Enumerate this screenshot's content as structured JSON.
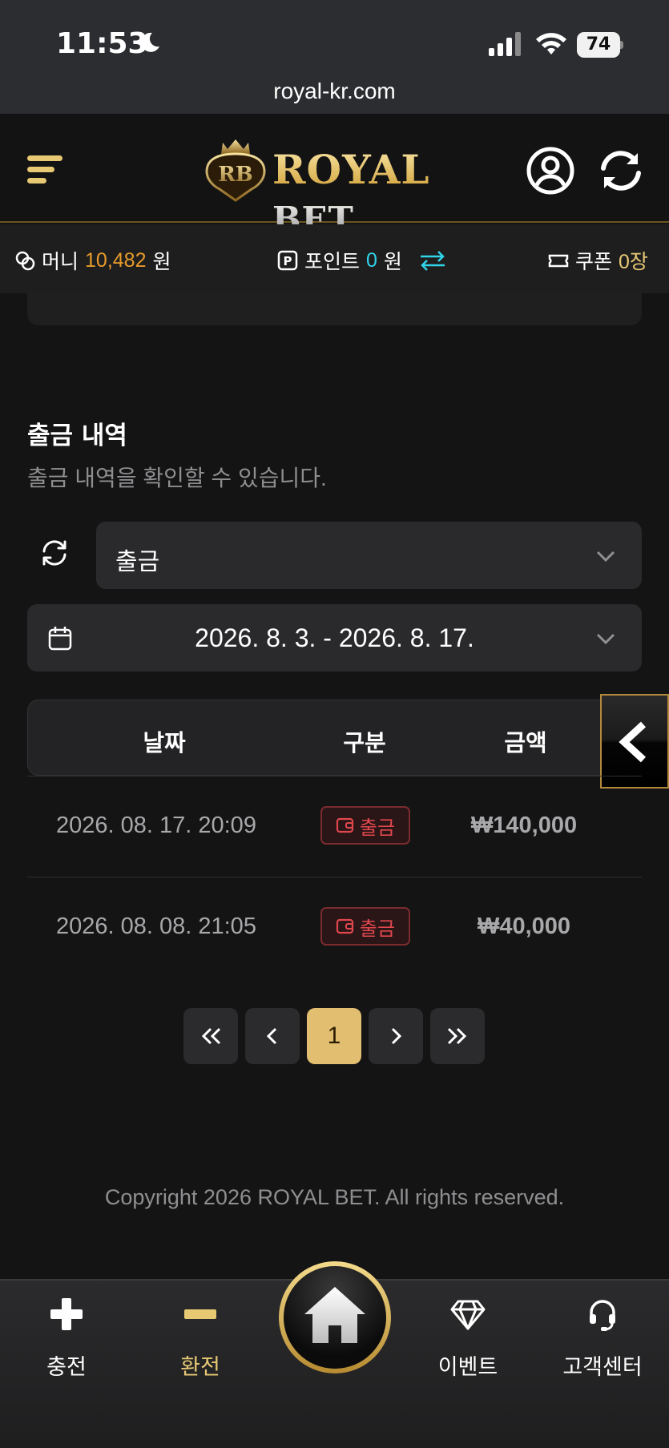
{
  "status_bar": {
    "time": "11:53",
    "battery": "74",
    "url": "royal-kr.com"
  },
  "header": {
    "logo_text_main": "ROYAL",
    "logo_text_accent": "BET",
    "logo_monogram": "RB"
  },
  "info_bar": {
    "money_label": "머니",
    "money_value": "10,482",
    "money_unit": "원",
    "point_label": "포인트",
    "point_value": "0",
    "point_unit": "원",
    "coupon_label": "쿠폰",
    "coupon_value": "0장"
  },
  "withdraw_history": {
    "title": "출금 내역",
    "description": "출금 내역을 확인할 수 있습니다.",
    "type_select": "출금",
    "date_range": "2026. 8. 3. - 2026. 8. 17.",
    "columns": [
      "날짜",
      "구분",
      "금액"
    ],
    "rows": [
      {
        "date": "2026. 08. 17. 20:09",
        "type": "출금",
        "amount": "₩140,000"
      },
      {
        "date": "2026. 08. 08. 21:05",
        "type": "출금",
        "amount": "₩40,000"
      }
    ]
  },
  "pagination": {
    "current_page": "1"
  },
  "footer": {
    "copyright": "Copyright 2026 ROYAL BET. All rights reserved."
  },
  "bottom_nav": {
    "charge": "충전",
    "exchange": "환전",
    "event": "이벤트",
    "support": "고객센터"
  },
  "colors": {
    "gold": "#e2be70",
    "money": "#e89b2a",
    "point": "#31d4e8",
    "withdraw_red": "#e0484e"
  }
}
